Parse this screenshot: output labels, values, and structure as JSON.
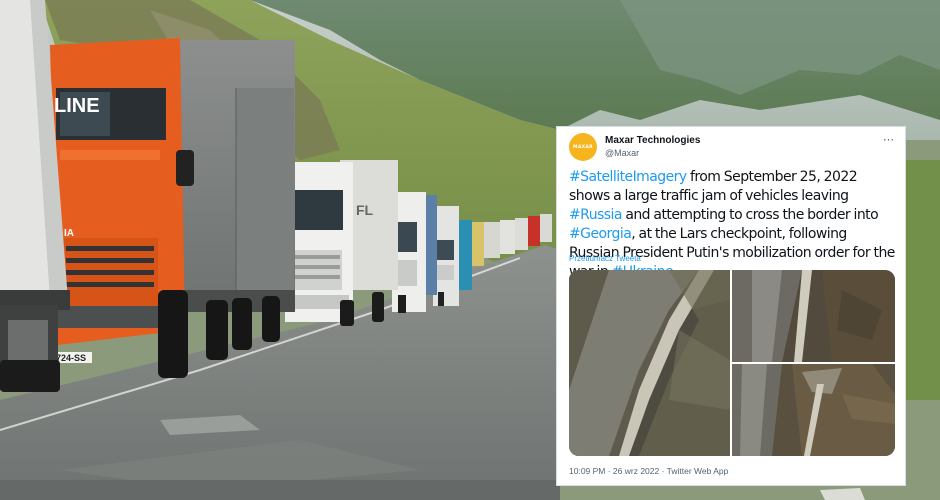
{
  "tweet": {
    "author_name": "Maxar Technologies",
    "author_handle": "@Maxar",
    "avatar_text": "MAXAR",
    "more_icon": "ellipsis-icon",
    "text": {
      "p1": "#SatelliteImagery",
      "p2": " from September 25, 2022 shows a large traffic jam of vehicles leaving ",
      "p3": "#Russia",
      "p4": " and attempting to cross the border into ",
      "p5": "#Georgia",
      "p6": ", at the Lars checkpoint, following Russian President Putin's mobilization order for the war in ",
      "p7": "#Ukraine",
      "p8": "."
    },
    "translate_label": "Przetłumacz Tweeta",
    "timestamp": "10:09 PM · 26 wrz 2022 · Twitter Web App"
  },
  "photo": {
    "truck_lettering": "LINE",
    "truck_brand": "IA",
    "plate": "724-SS",
    "white_truck_lettering": "FL"
  },
  "colors": {
    "link": "#1d9bf0",
    "avatar": "#f6b51e",
    "truck_orange": "#e65e1f"
  }
}
